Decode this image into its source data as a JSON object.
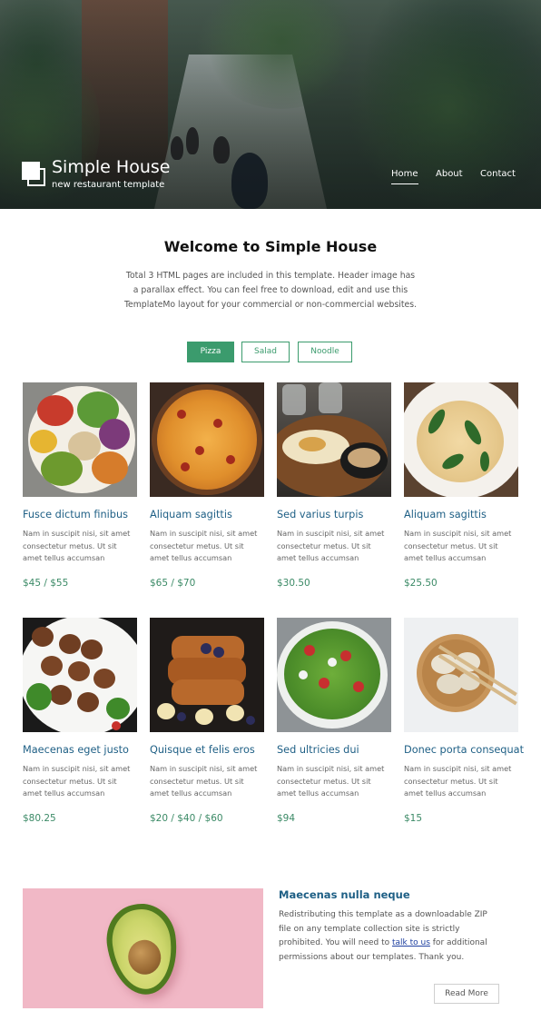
{
  "header": {
    "site_title": "Simple House",
    "tagline": "new restaurant template",
    "nav": [
      {
        "label": "Home",
        "active": true
      },
      {
        "label": "About",
        "active": false
      },
      {
        "label": "Contact",
        "active": false
      }
    ]
  },
  "welcome": {
    "title": "Welcome to Simple House",
    "text": "Total 3 HTML pages are included in this template. Header image has a parallax effect. You can feel free to download, edit and use this TemplateMo layout for your commercial or non-commercial websites."
  },
  "tabs": [
    {
      "label": "Pizza",
      "active": true
    },
    {
      "label": "Salad",
      "active": false
    },
    {
      "label": "Noodle",
      "active": false
    }
  ],
  "items": [
    {
      "title": "Fusce dictum finibus",
      "desc": "Nam in suscipit nisi, sit amet consectetur metus. Ut sit amet tellus accumsan",
      "price": "$45 / $55",
      "image": "salad-bowl-image"
    },
    {
      "title": "Aliquam sagittis",
      "desc": "Nam in suscipit nisi, sit amet consectetur metus. Ut sit amet tellus accumsan",
      "price": "$65 / $70",
      "image": "pizza-image"
    },
    {
      "title": "Sed varius turpis",
      "desc": "Nam in suscipit nisi, sit amet consectetur metus. Ut sit amet tellus accumsan",
      "price": "$30.50",
      "image": "grilled-dish-image"
    },
    {
      "title": "Aliquam sagittis",
      "desc": "Nam in suscipit nisi, sit amet consectetur metus. Ut sit amet tellus accumsan",
      "price": "$25.50",
      "image": "pasta-image"
    },
    {
      "title": "Maecenas eget justo",
      "desc": "Nam in suscipit nisi, sit amet consectetur metus. Ut sit amet tellus accumsan",
      "price": "$80.25",
      "image": "meatballs-image"
    },
    {
      "title": "Quisque et felis eros",
      "desc": "Nam in suscipit nisi, sit amet consectetur metus. Ut sit amet tellus accumsan",
      "price": "$20 / $40 / $60",
      "image": "french-toast-image"
    },
    {
      "title": "Sed ultricies dui",
      "desc": "Nam in suscipit nisi, sit amet consectetur metus. Ut sit amet tellus accumsan",
      "price": "$94",
      "image": "green-salad-image"
    },
    {
      "title": "Donec porta consequat",
      "desc": "Nam in suscipit nisi, sit amet consectetur metus. Ut sit amet tellus accumsan",
      "price": "$15",
      "image": "dumplings-image"
    }
  ],
  "feature": {
    "title": "Maecenas nulla neque",
    "text_before": "Redistributing this template as a downloadable ZIP file on any template collection site is strictly prohibited. You will need to ",
    "link_text": "talk to us",
    "text_after": " for additional permissions about our templates. Thank you.",
    "button_label": "Read More",
    "image": "avocado-image"
  },
  "colors": {
    "accent_green": "#3b9b6d",
    "title_blue": "#1e5f85",
    "price_green": "#3b8a66",
    "feature_pink": "#f1b8c6"
  }
}
